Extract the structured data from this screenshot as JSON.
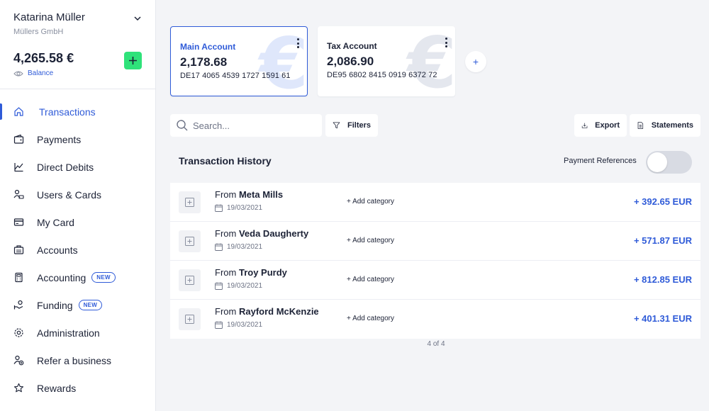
{
  "user": {
    "name": "Katarina Müller",
    "company": "Müllers GmbH"
  },
  "balance": {
    "amount": "4,265.58 €",
    "label": "Balance"
  },
  "nav": [
    {
      "label": "Transactions",
      "icon": "home-icon",
      "active": true,
      "badge": ""
    },
    {
      "label": "Payments",
      "icon": "wallet-icon",
      "active": false,
      "badge": ""
    },
    {
      "label": "Direct Debits",
      "icon": "chart-edit-icon",
      "active": false,
      "badge": ""
    },
    {
      "label": "Users & Cards",
      "icon": "user-card-icon",
      "active": false,
      "badge": ""
    },
    {
      "label": "My Card",
      "icon": "credit-card-icon",
      "active": false,
      "badge": ""
    },
    {
      "label": "Accounts",
      "icon": "briefcase-icon",
      "active": false,
      "badge": ""
    },
    {
      "label": "Accounting",
      "icon": "calculator-icon",
      "active": false,
      "badge": "NEW"
    },
    {
      "label": "Funding",
      "icon": "funding-icon",
      "active": false,
      "badge": "NEW"
    },
    {
      "label": "Administration",
      "icon": "gear-icon",
      "active": false,
      "badge": ""
    },
    {
      "label": "Refer a business",
      "icon": "refer-user-icon",
      "active": false,
      "badge": ""
    },
    {
      "label": "Rewards",
      "icon": "star-icon",
      "active": false,
      "badge": ""
    }
  ],
  "accounts": [
    {
      "name": "Main Account",
      "amount": "2,178.68",
      "iban": "DE17 4065 4539 1727 1591 61",
      "selected": true
    },
    {
      "name": "Tax Account",
      "amount": "2,086.90",
      "iban": "DE95 6802 8415 0919 6372 72",
      "selected": false
    }
  ],
  "add_account_label": "+",
  "toolbar": {
    "search_placeholder": "Search...",
    "filters": "Filters",
    "export": "Export",
    "statements": "Statements"
  },
  "history": {
    "title": "Transaction History",
    "payment_references_label": "Payment References",
    "payment_references_on": false
  },
  "transactions": [
    {
      "prefix": "From",
      "name": "Meta Mills",
      "date": "19/03/2021",
      "category": "+ Add category",
      "amount": "+ 392.65 EUR"
    },
    {
      "prefix": "From",
      "name": "Veda Daugherty",
      "date": "19/03/2021",
      "category": "+ Add category",
      "amount": "+ 571.87 EUR"
    },
    {
      "prefix": "From",
      "name": "Troy Purdy",
      "date": "19/03/2021",
      "category": "+ Add category",
      "amount": "+ 812.85 EUR"
    },
    {
      "prefix": "From",
      "name": "Rayford McKenzie",
      "date": "19/03/2021",
      "category": "+ Add category",
      "amount": "+ 401.31 EUR"
    }
  ],
  "pagination": "4 of 4",
  "colors": {
    "accent": "#2f5bd8",
    "add_green": "#2fe27a",
    "background": "#f3f4f7"
  }
}
